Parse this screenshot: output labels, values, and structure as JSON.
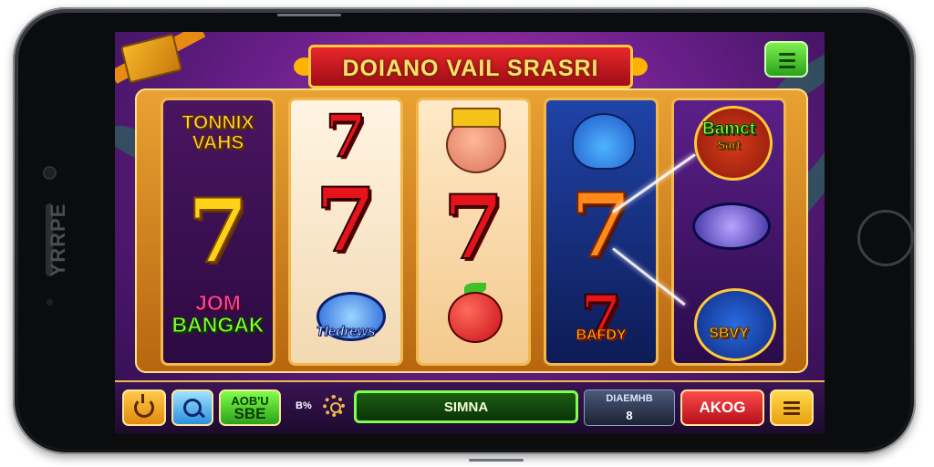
{
  "device": {
    "brand": "YRRPE"
  },
  "game": {
    "title": "DOIANO VAIL SRASRI",
    "reels": [
      {
        "top_text": [
          "TONNIX",
          "VAHS"
        ],
        "bottom_text": [
          "JOM",
          "BANGAK"
        ]
      },
      {
        "bottom_text": "Tledrews"
      },
      {},
      {
        "bottom_text": "BAFDY"
      },
      {
        "top_text": [
          "Bamct",
          "Sart"
        ],
        "bottom_text": "SBVY"
      }
    ],
    "symbols": [
      "seven-gold-icon",
      "seven-red-icon",
      "seven-orange-icon",
      "pig-king-icon",
      "apple-icon",
      "genie-icon",
      "gem-disc-icon"
    ]
  },
  "controls": {
    "power_icon": "power-icon",
    "search_icon": "magnifier-icon",
    "bet_line1": "AOB'U",
    "bet_line2": "SBE",
    "small_label": "B%",
    "spin_label": "SIMNA",
    "balance_label": "DIAEMHB",
    "balance_value": "8",
    "action_label": "AKOG",
    "menu_icon": "list-icon"
  },
  "colors": {
    "accent_gold": "#f2b84b",
    "spin_green": "#7fff4a",
    "action_red": "#b3101a",
    "background_purple": "#6a1f8a"
  }
}
